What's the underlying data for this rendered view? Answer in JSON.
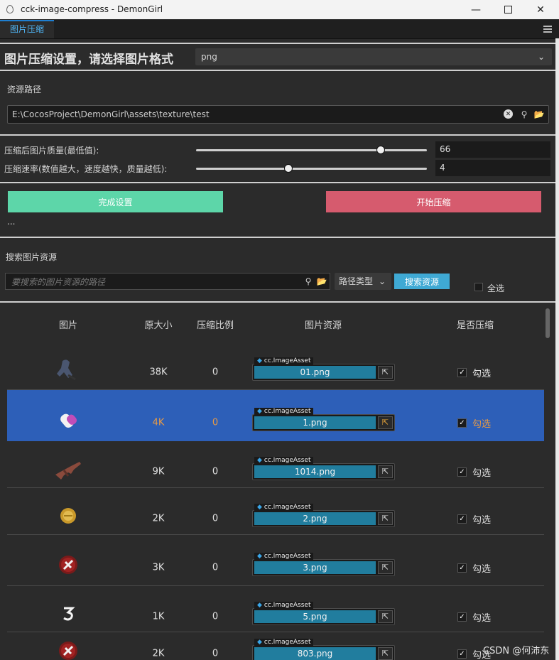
{
  "window": {
    "title": "cck-image-compress - DemonGirl",
    "minimize_icon": "minimize-icon",
    "maximize_icon": "maximize-icon",
    "close_icon": "close-icon"
  },
  "tab": {
    "label": "图片压缩"
  },
  "header": {
    "title": "图片压缩设置，请选择图片格式",
    "format_value": "png"
  },
  "resource": {
    "label": "资源路径",
    "path": "E:\\CocosProject\\DemonGirl\\assets\\texture\\test"
  },
  "quality": {
    "label": "压缩后图片质量(最低值):",
    "value": "66",
    "level_fraction": 0.8
  },
  "speed": {
    "label": "压缩速率(数值越大，速度越快，质量越低):",
    "value": "4",
    "level_fraction": 0.4
  },
  "actions": {
    "finish_label": "完成设置",
    "start_label": "开始压缩",
    "status": "...",
    "finish_color": "#5dd6a9",
    "start_color": "#d65b6e"
  },
  "search": {
    "section_label": "搜索图片资源",
    "placeholder": "要搜索的图片资源的路径",
    "path_type_label": "路径类型",
    "search_button_label": "搜索资源",
    "select_all_label": "全选"
  },
  "table": {
    "headers": {
      "image": "图片",
      "original_size": "原大小",
      "ratio": "压缩比例",
      "asset": "图片资源",
      "compress": "是否压缩"
    },
    "rows": [
      {
        "size": "38K",
        "ratio": "0",
        "asset_type": "cc.ImageAsset",
        "asset_name": "01.png",
        "check_label": "勾选",
        "checked": true,
        "selected": false
      },
      {
        "size": "4K",
        "ratio": "0",
        "asset_type": "cc.ImageAsset",
        "asset_name": "1.png",
        "check_label": "勾选",
        "checked": true,
        "selected": true
      },
      {
        "size": "9K",
        "ratio": "0",
        "asset_type": "cc.ImageAsset",
        "asset_name": "1014.png",
        "check_label": "勾选",
        "checked": true,
        "selected": false
      },
      {
        "size": "2K",
        "ratio": "0",
        "asset_type": "cc.ImageAsset",
        "asset_name": "2.png",
        "check_label": "勾选",
        "checked": true,
        "selected": false
      },
      {
        "size": "3K",
        "ratio": "0",
        "asset_type": "cc.ImageAsset",
        "asset_name": "3.png",
        "check_label": "勾选",
        "checked": true,
        "selected": false
      },
      {
        "size": "1K",
        "ratio": "0",
        "asset_type": "cc.ImageAsset",
        "asset_name": "5.png",
        "check_label": "勾选",
        "checked": true,
        "selected": false
      },
      {
        "size": "2K",
        "ratio": "0",
        "asset_type": "cc.ImageAsset",
        "asset_name": "803.png",
        "check_label": "勾选",
        "checked": true,
        "selected": false
      }
    ]
  },
  "colors": {
    "selected_row": "#2d5fb8",
    "selected_text": "#e79a45",
    "asset_field": "#217d9e",
    "accent_blue": "#3fa9d4"
  },
  "watermark": "CSDN @何沛东"
}
